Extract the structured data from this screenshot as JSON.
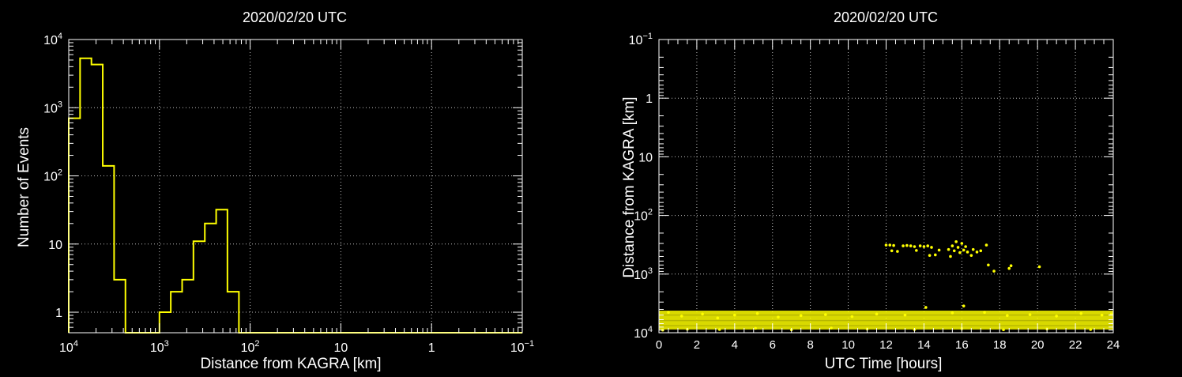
{
  "colors": {
    "background": "#000000",
    "axes": "#ffffff",
    "series": "#ffff00",
    "grid": "#bfbfbf"
  },
  "chart_data": [
    {
      "type": "histogram",
      "title": "2020/02/20 UTC",
      "xlabel": "Distance from KAGRA [km]",
      "ylabel": "Number of Events",
      "x_scale": "log-reversed",
      "y_scale": "log",
      "xlim": [
        10000,
        0.1
      ],
      "ylim": [
        0.5,
        10000
      ],
      "grid": true,
      "x_ticks": [
        {
          "value": 10000,
          "base": "10",
          "exp": "4"
        },
        {
          "value": 1000,
          "base": "10",
          "exp": "3"
        },
        {
          "value": 100,
          "base": "10",
          "exp": "2"
        },
        {
          "value": 10,
          "base": "10",
          "exp": ""
        },
        {
          "value": 1,
          "base": "1",
          "exp": ""
        },
        {
          "value": 0.1,
          "base": "10",
          "exp": "−1"
        }
      ],
      "y_ticks": [
        {
          "value": 1,
          "base": "1",
          "exp": ""
        },
        {
          "value": 10,
          "base": "10",
          "exp": ""
        },
        {
          "value": 100,
          "base": "10",
          "exp": "2"
        },
        {
          "value": 1000,
          "base": "10",
          "exp": "3"
        },
        {
          "value": 10000,
          "base": "10",
          "exp": "4"
        }
      ],
      "series": [
        {
          "bin_edges_log10": [
            4.0,
            3.875,
            3.75,
            3.625,
            3.5,
            3.375,
            3.25,
            3.125,
            3.0,
            2.875,
            2.75,
            2.625,
            2.5,
            2.375
          ],
          "counts": [
            700,
            5300,
            4300,
            140,
            3,
            0,
            0,
            0,
            1,
            2,
            3,
            11,
            20,
            32,
            2,
            0
          ],
          "bin_edges": [
            10000,
            7499,
            5623,
            4217,
            3162,
            2371,
            1778,
            1334,
            1000,
            750,
            562,
            422,
            316,
            237,
            178,
            133,
            100
          ]
        }
      ]
    },
    {
      "type": "scatter",
      "title": "2020/02/20 UTC",
      "xlabel": "UTC Time [hours]",
      "ylabel": "Distance from KAGRA [km]",
      "x_scale": "linear",
      "y_scale": "log-reversed",
      "xlim": [
        0,
        24
      ],
      "ylim": [
        10000,
        0.1
      ],
      "grid": true,
      "x_ticks": [
        "0",
        "2",
        "4",
        "6",
        "8",
        "10",
        "12",
        "14",
        "16",
        "18",
        "20",
        "22",
        "24"
      ],
      "y_ticks": [
        {
          "value": 0.1,
          "base": "10",
          "exp": "−1"
        },
        {
          "value": 1,
          "base": "1",
          "exp": ""
        },
        {
          "value": 10,
          "base": "10",
          "exp": ""
        },
        {
          "value": 100,
          "base": "10",
          "exp": "2"
        },
        {
          "value": 1000,
          "base": "10",
          "exp": "3"
        },
        {
          "value": 10000,
          "base": "10",
          "exp": "4"
        }
      ],
      "points": [
        {
          "x": 12.0,
          "y": 320
        },
        {
          "x": 12.2,
          "y": 320
        },
        {
          "x": 12.4,
          "y": 325
        },
        {
          "x": 12.3,
          "y": 400
        },
        {
          "x": 12.6,
          "y": 410
        },
        {
          "x": 12.9,
          "y": 330
        },
        {
          "x": 13.1,
          "y": 325
        },
        {
          "x": 13.3,
          "y": 330
        },
        {
          "x": 13.5,
          "y": 340
        },
        {
          "x": 13.6,
          "y": 395
        },
        {
          "x": 13.8,
          "y": 330
        },
        {
          "x": 14.0,
          "y": 340
        },
        {
          "x": 14.2,
          "y": 330
        },
        {
          "x": 14.4,
          "y": 350
        },
        {
          "x": 14.3,
          "y": 480
        },
        {
          "x": 14.6,
          "y": 470
        },
        {
          "x": 14.8,
          "y": 390
        },
        {
          "x": 15.3,
          "y": 380
        },
        {
          "x": 15.5,
          "y": 330
        },
        {
          "x": 15.4,
          "y": 500
        },
        {
          "x": 15.6,
          "y": 400
        },
        {
          "x": 15.7,
          "y": 280
        },
        {
          "x": 15.8,
          "y": 350
        },
        {
          "x": 15.9,
          "y": 430
        },
        {
          "x": 16.0,
          "y": 300
        },
        {
          "x": 16.1,
          "y": 390
        },
        {
          "x": 16.2,
          "y": 340
        },
        {
          "x": 16.3,
          "y": 420
        },
        {
          "x": 16.5,
          "y": 480
        },
        {
          "x": 16.6,
          "y": 380
        },
        {
          "x": 16.8,
          "y": 420
        },
        {
          "x": 17.0,
          "y": 400
        },
        {
          "x": 17.3,
          "y": 320
        },
        {
          "x": 17.4,
          "y": 700
        },
        {
          "x": 17.7,
          "y": 890
        },
        {
          "x": 18.5,
          "y": 800
        },
        {
          "x": 18.6,
          "y": 720
        },
        {
          "x": 20.1,
          "y": 750
        },
        {
          "x": 0.5,
          "y": 4500
        },
        {
          "x": 1.2,
          "y": 5200
        },
        {
          "x": 2.3,
          "y": 4800
        },
        {
          "x": 3.1,
          "y": 5600
        },
        {
          "x": 4.0,
          "y": 5000
        },
        {
          "x": 5.2,
          "y": 4700
        },
        {
          "x": 6.3,
          "y": 5400
        },
        {
          "x": 7.5,
          "y": 5100
        },
        {
          "x": 8.8,
          "y": 4900
        },
        {
          "x": 10.2,
          "y": 5300
        },
        {
          "x": 11.5,
          "y": 4800
        },
        {
          "x": 13.0,
          "y": 5000
        },
        {
          "x": 14.1,
          "y": 3700
        },
        {
          "x": 15.5,
          "y": 4600
        },
        {
          "x": 16.1,
          "y": 3500
        },
        {
          "x": 17.2,
          "y": 4500
        },
        {
          "x": 18.4,
          "y": 5100
        },
        {
          "x": 19.6,
          "y": 4900
        },
        {
          "x": 21.0,
          "y": 5200
        },
        {
          "x": 22.3,
          "y": 4700
        },
        {
          "x": 23.4,
          "y": 5000
        },
        {
          "x": 23.9,
          "y": 4800
        },
        {
          "x": 0.2,
          "y": 9000
        },
        {
          "x": 1.5,
          "y": 8700
        },
        {
          "x": 3.2,
          "y": 8800
        },
        {
          "x": 5.1,
          "y": 8400
        },
        {
          "x": 7.0,
          "y": 8900
        },
        {
          "x": 9.1,
          "y": 8300
        },
        {
          "x": 11.0,
          "y": 8600
        },
        {
          "x": 13.5,
          "y": 8800
        },
        {
          "x": 16.0,
          "y": 8500
        },
        {
          "x": 18.2,
          "y": 8900
        },
        {
          "x": 20.5,
          "y": 8600
        },
        {
          "x": 22.8,
          "y": 8800
        }
      ],
      "band": {
        "xmin": 0,
        "xmax": 24,
        "ymin": 4200,
        "ymax": 8800
      }
    }
  ]
}
